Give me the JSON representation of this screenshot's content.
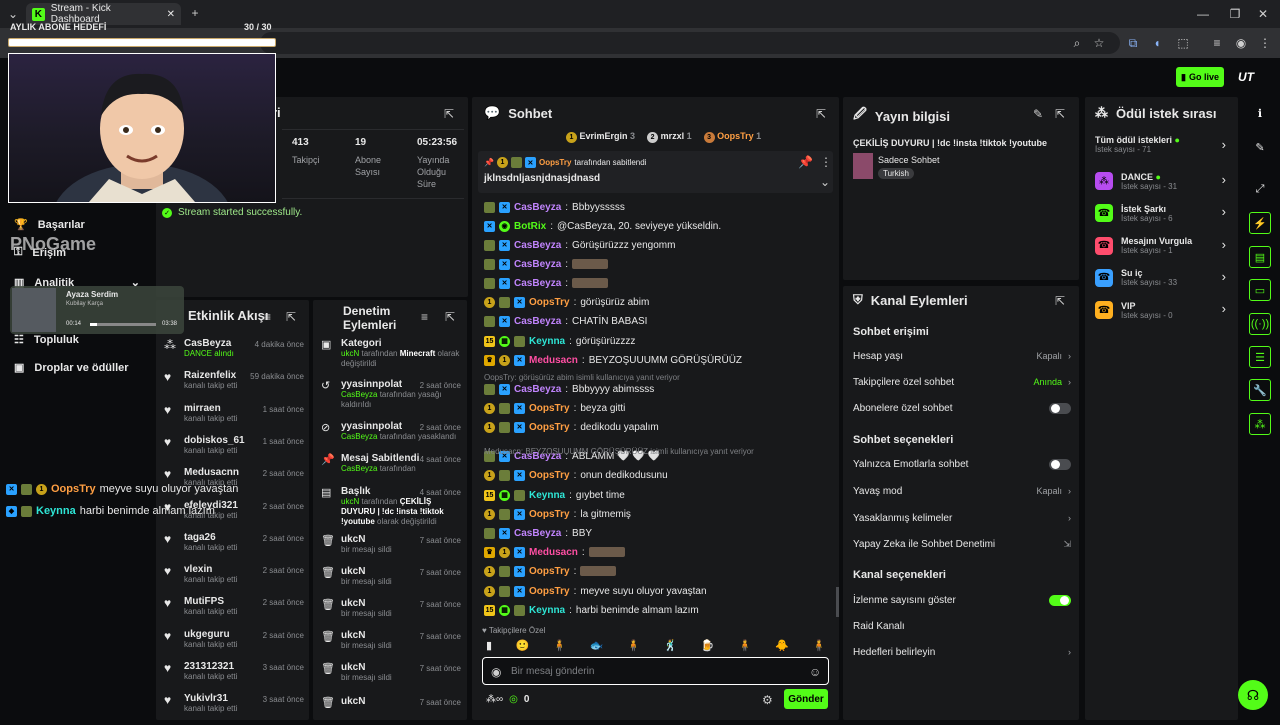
{
  "browser": {
    "tab_title": "Stream - Kick Dashboard",
    "new_tab": "+"
  },
  "overlay": {
    "goal_title": "AYLIK ABONE HEDEFİ",
    "goal_count": "30 / 30",
    "music_title": "Ayaza Serdim",
    "music_artist": "Kubilay Karça",
    "music_time_current": "00:14",
    "music_time_total": "03:38",
    "brand_watermark": "PNoGame",
    "overlay_chat": [
      {
        "user": "OopsTry",
        "text": "meyve suyu oluyor yavaştan"
      },
      {
        "user": "Keynna",
        "text": "harbi benimde almam lazım"
      }
    ]
  },
  "appbar": {
    "go_live": "Go live"
  },
  "nav": {
    "items": [
      {
        "label": "Başarılar"
      },
      {
        "label": "Erişim"
      },
      {
        "label": "Analitik"
      },
      {
        "label": "Topluluk"
      },
      {
        "label": "Droplar ve ödüller"
      }
    ]
  },
  "stats": {
    "title_fragment": "ri",
    "items": [
      {
        "value": "413",
        "label": "Takipçi"
      },
      {
        "value": "19",
        "label": "Abone Sayısı"
      },
      {
        "value": "05:23:56",
        "label": "Yayında Olduğu Süre"
      }
    ],
    "toast": "Stream started successfully."
  },
  "activity": {
    "title": "Etkinlik Akışı",
    "rows": [
      {
        "name": "CasBeyza",
        "detail": "DANCE alındı",
        "time": "4 dakika önce"
      },
      {
        "name": "Raizenfelix",
        "detail": "kanalı takip etti",
        "time": "59 dakika önce"
      },
      {
        "name": "mirraen",
        "detail": "kanalı takip etti",
        "time": "1 saat önce"
      },
      {
        "name": "dobiskos_61",
        "detail": "kanalı takip etti",
        "time": "1 saat önce"
      },
      {
        "name": "Medusacnn",
        "detail": "kanalı takip etti",
        "time": "2 saat önce"
      },
      {
        "name": "efeleydi321",
        "detail": "kanalı takip etti",
        "time": "2 saat önce"
      },
      {
        "name": "taga26",
        "detail": "kanalı takip etti",
        "time": "2 saat önce"
      },
      {
        "name": "vlexin",
        "detail": "kanalı takip etti",
        "time": "2 saat önce"
      },
      {
        "name": "MutiFPS",
        "detail": "kanalı takip etti",
        "time": "2 saat önce"
      },
      {
        "name": "ukgeguru",
        "detail": "kanalı takip etti",
        "time": "2 saat önce"
      },
      {
        "name": "231312321",
        "detail": "kanalı takip etti",
        "time": "3 saat önce"
      },
      {
        "name": "Yukivlr31",
        "detail": "kanalı takip etti",
        "time": "3 saat önce"
      }
    ]
  },
  "moderation": {
    "title_line1": "Denetim",
    "title_line2": "Eylemleri",
    "rows": [
      {
        "title": "Kategori",
        "actor": "ukcN",
        "mid": "tarafından",
        "hl": "Minecraft",
        "tail": "olarak değiştirildi",
        "time": ""
      },
      {
        "title": "yyasinnpolat",
        "actor": "CasBeyza",
        "mid": "tarafından yasağı kaldırıldı",
        "hl": "",
        "tail": "",
        "time": "2 saat önce"
      },
      {
        "title": "yyasinnpolat",
        "actor": "CasBeyza",
        "mid": "tarafından yasaklandı",
        "hl": "",
        "tail": "",
        "time": "2 saat önce"
      },
      {
        "title": "Mesaj Sabitlendi",
        "actor": "CasBeyza",
        "mid": "tarafından",
        "hl": "",
        "tail": "",
        "time": "4 saat önce"
      },
      {
        "title": "Başlık",
        "actor": "ukcN",
        "mid": "tarafından",
        "hl": "ÇEKİLİŞ DUYURU | !dc !insta !tiktok !youtube",
        "tail": "olarak değiştirildi",
        "time": "4 saat önce"
      },
      {
        "title": "ukcN",
        "actor": "",
        "mid": "bir mesajı sildi",
        "hl": "",
        "tail": "",
        "time": "7 saat önce"
      },
      {
        "title": "ukcN",
        "actor": "",
        "mid": "bir mesajı sildi",
        "hl": "",
        "tail": "",
        "time": "7 saat önce"
      },
      {
        "title": "ukcN",
        "actor": "",
        "mid": "bir mesajı sildi",
        "hl": "",
        "tail": "",
        "time": "7 saat önce"
      },
      {
        "title": "ukcN",
        "actor": "",
        "mid": "bir mesajı sildi",
        "hl": "",
        "tail": "",
        "time": "7 saat önce"
      },
      {
        "title": "ukcN",
        "actor": "",
        "mid": "bir mesajı sildi",
        "hl": "",
        "tail": "",
        "time": "7 saat önce"
      },
      {
        "title": "ukcN",
        "actor": "",
        "mid": "",
        "hl": "",
        "tail": "",
        "time": "7 saat önce"
      }
    ]
  },
  "chat": {
    "title": "Sohbet",
    "top_gifters": [
      {
        "name": "EvrimErgin",
        "count": "3"
      },
      {
        "name": "mrzxl",
        "count": "1"
      },
      {
        "name": "OopsTry",
        "count": "1"
      }
    ],
    "pinned_by": "OopsTry",
    "pinned_label": "tarafından sabitlendi",
    "pinned_text": "jklnsdnljasnjdnasjdnasd",
    "messages": [
      {
        "user": "CasBeyza",
        "color": "#c084fc",
        "text": "Bbbyysssss"
      },
      {
        "user": "BotRix",
        "color": "#53fc18",
        "text": "@CasBeyza, 20. seviyeye yükseldin."
      },
      {
        "user": "CasBeyza",
        "color": "#c084fc",
        "text": "Görüşürüzzz yengomm"
      },
      {
        "user": "CasBeyza",
        "color": "#c084fc",
        "text": ""
      },
      {
        "user": "CasBeyza",
        "color": "#c084fc",
        "text": ""
      },
      {
        "user": "OopsTry",
        "color": "#ff9f43",
        "text": "görüşürüz abim"
      },
      {
        "user": "CasBeyza",
        "color": "#c084fc",
        "text": "CHATİN BABASI"
      },
      {
        "user": "Keynna",
        "color": "#2ee6d6",
        "text": "görüşürüzzzz"
      },
      {
        "user": "Medusacn",
        "color": "#ff4fa3",
        "text": "BEYZOŞUUUMM GÖRÜŞÜRÜÜZ"
      },
      {
        "user": "CasBeyza",
        "color": "#c084fc",
        "text": "Bbbyyyy abimssss"
      },
      {
        "user": "OopsTry",
        "color": "#ff9f43",
        "text": "beyza gitti"
      },
      {
        "user": "OopsTry",
        "color": "#ff9f43",
        "text": "dedikodu yapalım"
      },
      {
        "user": "CasBeyza",
        "color": "#c084fc",
        "text": "ABLAMM 🤍 🤍 🤍"
      },
      {
        "user": "OopsTry",
        "color": "#ff9f43",
        "text": "onun dedikodusunu"
      },
      {
        "user": "Keynna",
        "color": "#2ee6d6",
        "text": "gıybet time"
      },
      {
        "user": "OopsTry",
        "color": "#ff9f43",
        "text": "la gitmemiş"
      },
      {
        "user": "CasBeyza",
        "color": "#c084fc",
        "text": "BBY"
      },
      {
        "user": "Medusacn",
        "color": "#ff4fa3",
        "text": ""
      },
      {
        "user": "OopsTry",
        "color": "#ff9f43",
        "text": ""
      },
      {
        "user": "OopsTry",
        "color": "#ff9f43",
        "text": "meyve suyu oluyor yavaştan"
      },
      {
        "user": "Keynna",
        "color": "#2ee6d6",
        "text": "harbi benimde almam lazım"
      }
    ],
    "reply_1": "OopsTry: görüşürüz abim isimli kullanıcıya yanıt veriyor",
    "reply_2": "Medusacn: BEYZOŞUUUMM GÖRÜŞÜRÜÜZ isimli kullanıcıya yanıt veriyor",
    "followers_only": "Takipçilere Özel",
    "input_placeholder": "Bir mesaj gönderin",
    "points": "0",
    "send": "Gönder"
  },
  "stream_info": {
    "title": "Yayın bilgisi",
    "stream_title": "ÇEKİLİŞ DUYURU | !dc !insta !tiktok !youtube",
    "category": "Sadece Sohbet",
    "tag": "Turkish"
  },
  "channel_actions": {
    "title": "Kanal Eylemleri",
    "sec1": "Sohbet erişimi",
    "age": "Hesap yaşı",
    "age_val": "Kapalı",
    "followers": "Takipçilere özel sohbet",
    "followers_val": "Anında",
    "subs": "Abonelere özel sohbet",
    "sec2": "Sohbet seçenekleri",
    "emotes": "Yalnızca Emotlarla sohbet",
    "slow": "Yavaş mod",
    "slow_val": "Kapalı",
    "banned": "Yasaklanmış kelimeler",
    "ai": "Yapay Zeka ile Sohbet Denetimi",
    "sec3": "Kanal seçenekleri",
    "viewers": "İzlenme sayısını göster",
    "raid": "Raid Kanalı",
    "goals": "Hedefleri belirleyin"
  },
  "rewards": {
    "title": "Ödül istek sırası",
    "all": "Tüm ödül istekleri",
    "all_count": "İstek sayısı - 71",
    "items": [
      {
        "name": "DANCE",
        "count": "İstek sayısı - 31",
        "color": "#b74cf0"
      },
      {
        "name": "İstek Şarkı",
        "count": "İstek sayısı - 6",
        "color": "#53fc18"
      },
      {
        "name": "Mesajını Vurgula",
        "count": "İstek sayısı - 1",
        "color": "#ff4d6d"
      },
      {
        "name": "Su iç",
        "count": "İstek sayısı - 33",
        "color": "#3aa0ff"
      },
      {
        "name": "VIP",
        "count": "İstek sayısı - 0",
        "color": "#ffb020"
      }
    ]
  }
}
